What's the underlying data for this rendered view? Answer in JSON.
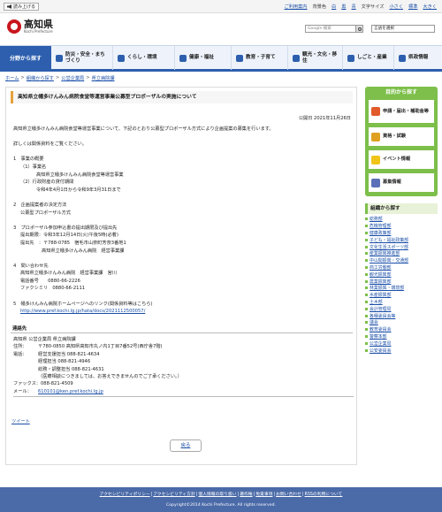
{
  "util": {
    "read_label": "読み上げる",
    "links": [
      "ご利用案内",
      "背景色",
      "白",
      "黒",
      "青",
      "文字サイズ",
      "小さく",
      "標準",
      "大きく"
    ]
  },
  "header": {
    "pref_name": "高知県",
    "pref_sub": "Kochi Prefecture",
    "search_placeholder": "Google 検索",
    "lang_label": "言語を選択"
  },
  "gnav": {
    "head": "分野から探す",
    "items": [
      "防災・安全・まちづくり",
      "くらし・環境",
      "健康・福祉",
      "教育・子育て",
      "観光・文化・移住",
      "しごと・産業",
      "県政情報"
    ]
  },
  "breadcrumb": [
    "ホーム",
    "組織から探す",
    "公営企業局",
    "県立病院課"
  ],
  "page": {
    "title": "高知県立幡多けんみん病院食堂等運営事業公募型プロポーザルの実施について",
    "pubdate": "公開日 2021年11月26日",
    "intro": "高知県立幡多けんみん病院食堂等運営事業について、下記のとおり公募型プロポーザル方式により企画提案の募集を行います。",
    "detail": "詳しくは関係資料をご覧ください。",
    "s1": "1　事業の概要",
    "s1_1": "（1）事業名",
    "s1_1v": "高知県立幡多けんみん病院食堂等運営事業",
    "s1_2": "（2）行政財産の貸付期間",
    "s1_2v": "令和4年4月1日から令和9年3月31日まで",
    "s2": "2　企画提案者の決定方法",
    "s2v": "公募型プロポーザル方式",
    "s3": "3　プロポーザル参加申込書の提出期限及び提出先",
    "s3a": "提出期限：令和3年12月14日(火)午後5時(必着)",
    "s3b": "提出先　：〒788-0785　宿毛市山奈町芳奈3番地1",
    "s3c": "高知県立幡多けんみん病院　経営事業課",
    "s4": "4　問い合わせ先",
    "s4a": "高知県立幡多けんみん病院　経営事業課　宮川",
    "s4b": "電話番号　　0880-66-2226",
    "s4c": "ファクシミリ　0880-66-2111",
    "s5": "5　幡多けんみん病院ホームページへのリンク(関係資料等はこちら)",
    "s5link": "http://www.pref.kochi.lg.jp/hata/docs/2021112500057/"
  },
  "contact": {
    "heading": "連絡先",
    "org": "高知県 公営企業局 県立病院課",
    "addr_k": "住所：",
    "addr_v": "〒780-0850 高知県高知市丸ノ内1丁目7番52号(西庁舎7階)",
    "tel_k": "電話：",
    "tel1": "経営支援担当 088-821-4634",
    "tel2": "経理担当 088-821-4946",
    "tel3": "総務・調整担当 088-821-4631",
    "note": "（医療相談につきましては、お答えできませんのでご了承ください。）",
    "fax": "ファックス：088-821-4509",
    "mail_k": "メール：",
    "mail_v": "610101@ken.pref.kochi.lg.jp"
  },
  "tweet": "ツイート",
  "back": "戻る",
  "sidebar": {
    "purpose_title": "目的から探す",
    "purpose_items": [
      {
        "label": "申請・届出・補助金等",
        "color": "#e05a2a"
      },
      {
        "label": "資格・試験",
        "color": "#e0a020"
      },
      {
        "label": "イベント情報",
        "color": "#f0c419"
      },
      {
        "label": "募集情報",
        "color": "#5b6fb8"
      }
    ],
    "org_title": "組織から探す",
    "org_items": [
      "総務部",
      "危機管理部",
      "健康政策部",
      "子ども・福祉政策部",
      "文化生活スポーツ部",
      "産業振興推進部",
      "中山間振興・交通部",
      "商工労働部",
      "観光振興部",
      "農業振興部",
      "林業振興・環境部",
      "水産振興部",
      "土木部",
      "会計管理局",
      "各種委員会等",
      "議会",
      "教育委員会",
      "警察本部",
      "公営企業局",
      "公安委員会"
    ]
  },
  "footer": {
    "links": [
      "アクセシビリティポリシー",
      "アクセシビリティ方針",
      "個人情報の取り扱い",
      "著作権",
      "免責事項",
      "お問い合わせ",
      "RSSの利用について"
    ],
    "copyright": "Copyright©2014 Kochi Prefecture. All rights reserved."
  }
}
